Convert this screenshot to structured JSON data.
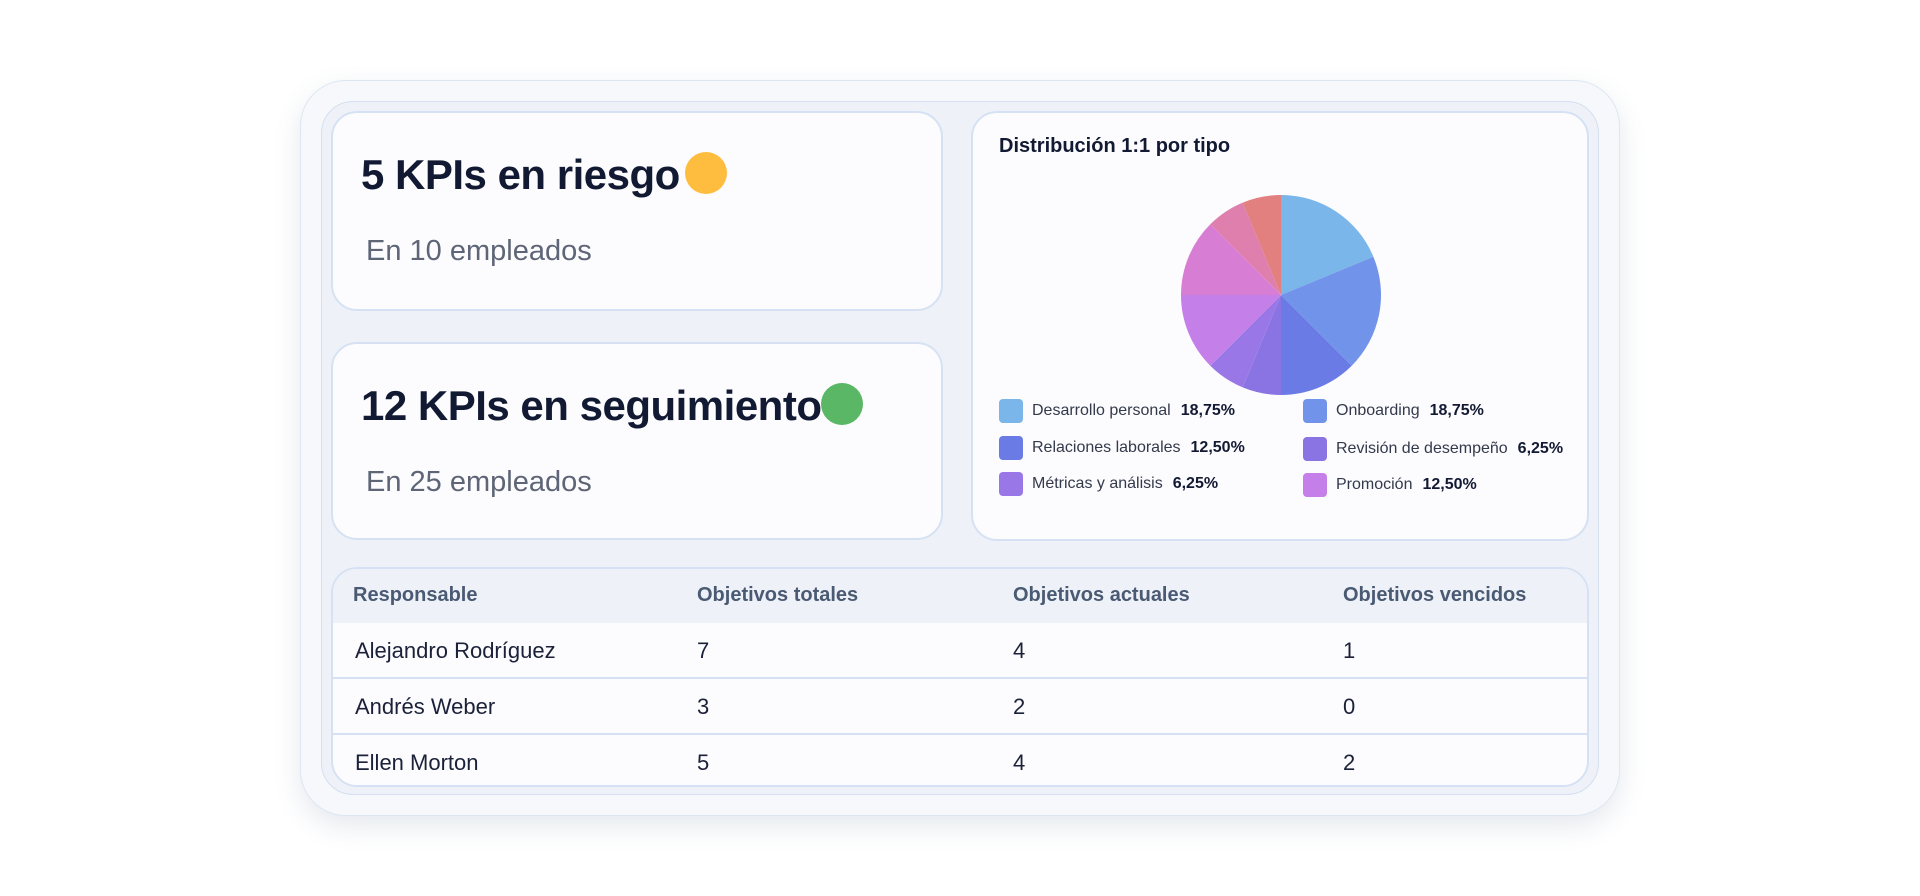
{
  "kpi_at_risk": {
    "title": "5 KPIs en riesgo",
    "subtitle": "En 10 empleados",
    "status_color": "#ffbd3f"
  },
  "kpi_tracking": {
    "title": "12 KPIs en seguimiento",
    "subtitle": "En 25 empleados",
    "status_color": "#59b765"
  },
  "chart_data": {
    "type": "pie",
    "title": "Distribución 1:1 por tipo",
    "legend_position": "bottom",
    "slices": [
      {
        "label": "Desarrollo personal",
        "value": 18.75,
        "value_label": "18,75%",
        "color": "#7bb6ea"
      },
      {
        "label": "Onboarding",
        "value": 18.75,
        "value_label": "18,75%",
        "color": "#7193ea"
      },
      {
        "label": "Relaciones laborales",
        "value": 12.5,
        "value_label": "12,50%",
        "color": "#6a7be6"
      },
      {
        "label": "Revisión de desempeño",
        "value": 6.25,
        "value_label": "6,25%",
        "color": "#8a74e3"
      },
      {
        "label": "Métricas y análisis",
        "value": 6.25,
        "value_label": "6,25%",
        "color": "#9a77e6"
      },
      {
        "label": "Promoción",
        "value": 12.5,
        "value_label": "12,50%",
        "color": "#c57fe8"
      },
      {
        "label": "",
        "value": 12.5,
        "value_label": "",
        "color": "#d77ed4"
      },
      {
        "label": "",
        "value": 6.25,
        "value_label": "",
        "color": "#de7fae"
      },
      {
        "label": "",
        "value": 6.25,
        "value_label": "",
        "color": "#e2807f"
      }
    ]
  },
  "table": {
    "columns": [
      "Responsable",
      "Objetivos totales",
      "Objetivos actuales",
      "Objetivos vencidos"
    ],
    "rows": [
      [
        "Alejandro Rodríguez",
        "7",
        "4",
        "1"
      ],
      [
        "Andrés Weber",
        "3",
        "2",
        "0"
      ],
      [
        "Ellen Morton",
        "5",
        "4",
        "2"
      ]
    ]
  }
}
